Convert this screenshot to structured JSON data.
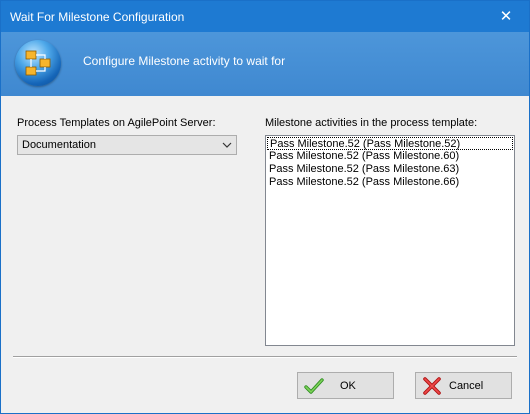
{
  "window": {
    "title": "Wait For Milestone Configuration",
    "close_glyph": "✕"
  },
  "header": {
    "text": "Configure Milestone activity to wait for",
    "icon": "process-diagram-icon"
  },
  "templates": {
    "label": "Process Templates on AgilePoint Server:",
    "selected": "Documentation"
  },
  "milestones": {
    "label": "Milestone activities in the process template:",
    "selected_index": 0,
    "items": [
      "Pass Milestone.52 (Pass Milestone.52)",
      "Pass Milestone.52 (Pass Milestone.60)",
      "Pass Milestone.52 (Pass Milestone.63)",
      "Pass Milestone.52 (Pass Milestone.66)"
    ]
  },
  "buttons": {
    "ok_label": "OK",
    "cancel_label": "Cancel"
  },
  "colors": {
    "titlebar": "#1e7ad2",
    "header": "#4d96da",
    "ok_check": "#3aa52a",
    "cancel_x": "#d42020"
  }
}
